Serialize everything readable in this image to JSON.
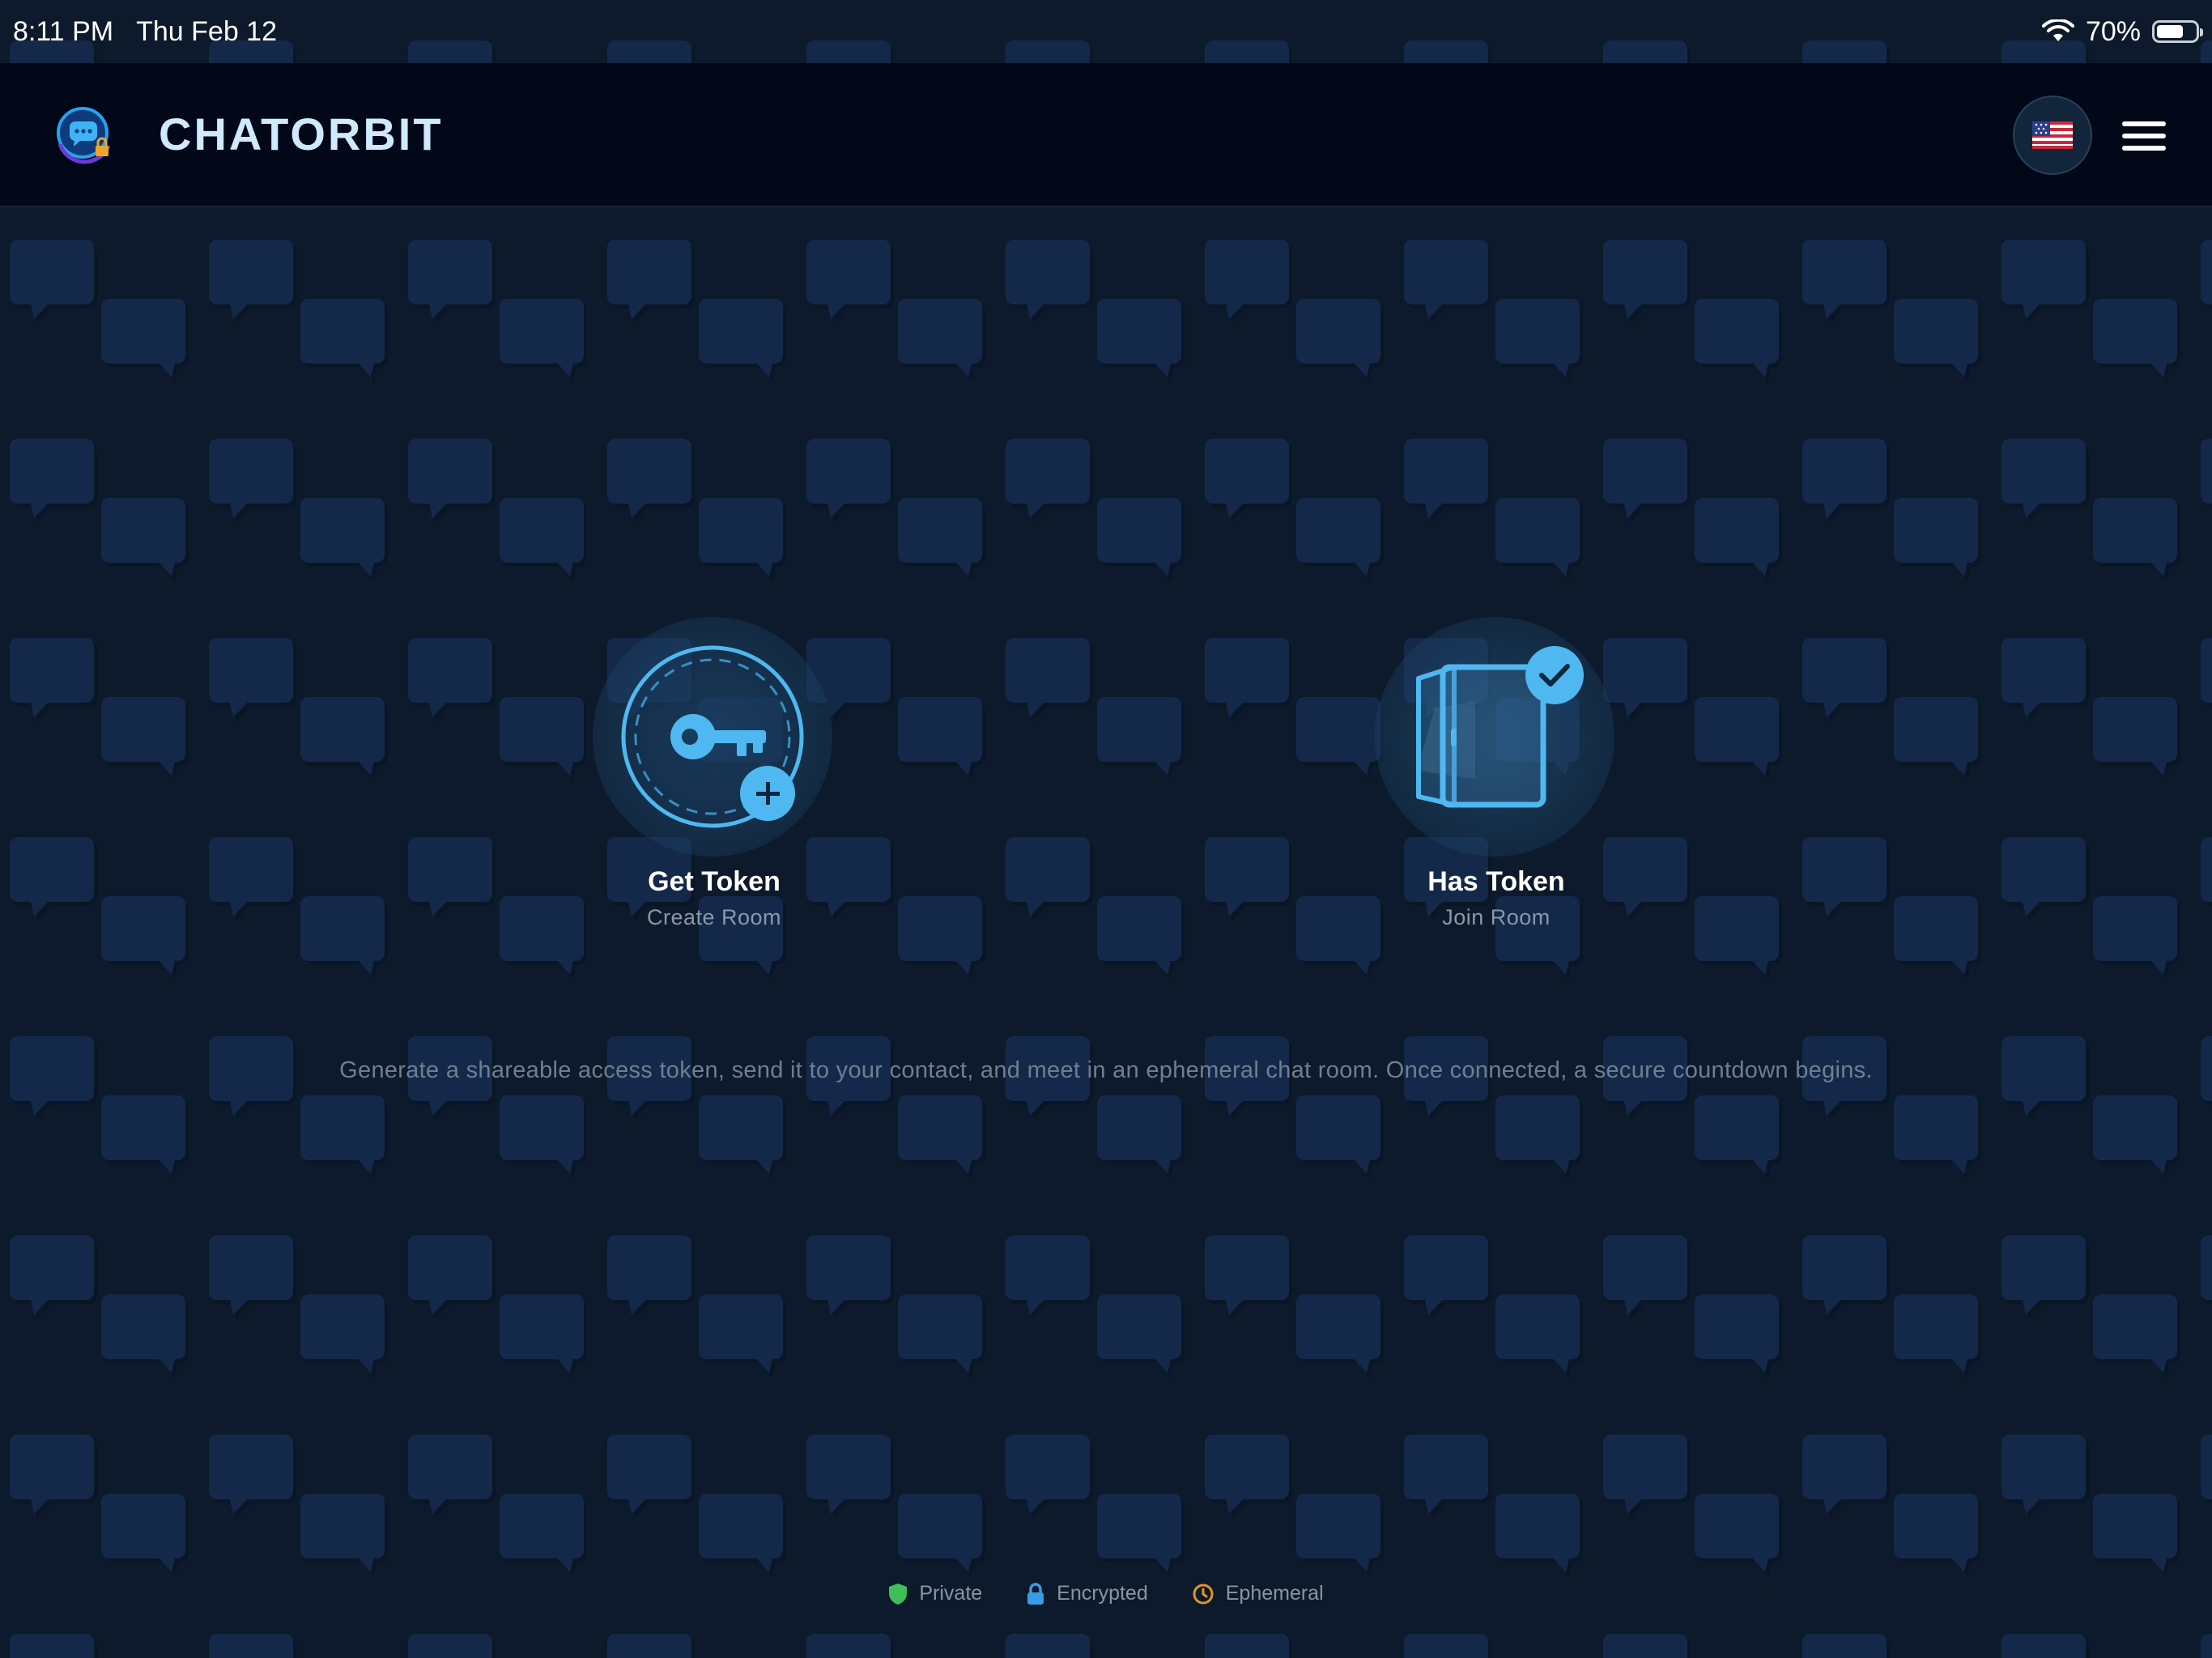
{
  "status_bar": {
    "time": "8:11 PM",
    "date": "Thu Feb 12",
    "battery_text": "70%",
    "battery_level": 0.7
  },
  "header": {
    "title": "CHATORBIT",
    "logo_icon": "chat-bubble-lock-logo",
    "language_icon": "us-flag-icon",
    "menu_icon": "hamburger-menu-icon"
  },
  "actions": [
    {
      "title": "Get Token",
      "subtitle": "Create Room",
      "icon": "key-plus-icon"
    },
    {
      "title": "Has Token",
      "subtitle": "Join Room",
      "icon": "door-check-icon"
    }
  ],
  "description": "Generate a shareable access token, send it to your contact, and meet in an ephemeral chat room. Once connected, a secure countdown begins.",
  "features": [
    {
      "label": "Private",
      "icon": "shield-icon",
      "color": "#3fbf5a"
    },
    {
      "label": "Encrypted",
      "icon": "lock-icon",
      "color": "#3a9be6"
    },
    {
      "label": "Ephemeral",
      "icon": "clock-icon",
      "color": "#e0952a"
    }
  ],
  "colors": {
    "background": "#0c1a2b",
    "header": "#020817",
    "accent": "#4fb8f0",
    "title": "#cfe9ff"
  }
}
